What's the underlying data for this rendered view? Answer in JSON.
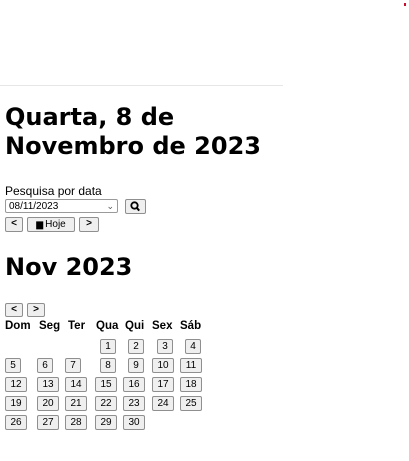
{
  "page": {
    "heading": "Quarta, 8 de Novembro de 2023"
  },
  "search": {
    "label": "Pesquisa por data",
    "date_value": "08/11/2023",
    "search_icon": "search-icon"
  },
  "nav": {
    "prev_label": "<",
    "today_label": "Hoje",
    "today_icon": "calendar-icon",
    "next_label": ">"
  },
  "calendar": {
    "month_title": "Nov 2023",
    "prev_month_label": "<",
    "next_month_label": ">",
    "weekdays": [
      "Dom",
      "Seg",
      "Ter",
      "Qua",
      "Qui",
      "Sex",
      "Sáb"
    ],
    "weeks": [
      [
        "",
        "",
        "",
        "1",
        "2",
        "3",
        "4"
      ],
      [
        "5",
        "6",
        "7",
        "8",
        "9",
        "10",
        "11"
      ],
      [
        "12",
        "13",
        "14",
        "15",
        "16",
        "17",
        "18"
      ],
      [
        "19",
        "20",
        "21",
        "22",
        "23",
        "24",
        "25"
      ],
      [
        "26",
        "27",
        "28",
        "29",
        "30",
        "",
        ""
      ]
    ]
  },
  "colors": {
    "accent_dot": "#c8102e"
  }
}
